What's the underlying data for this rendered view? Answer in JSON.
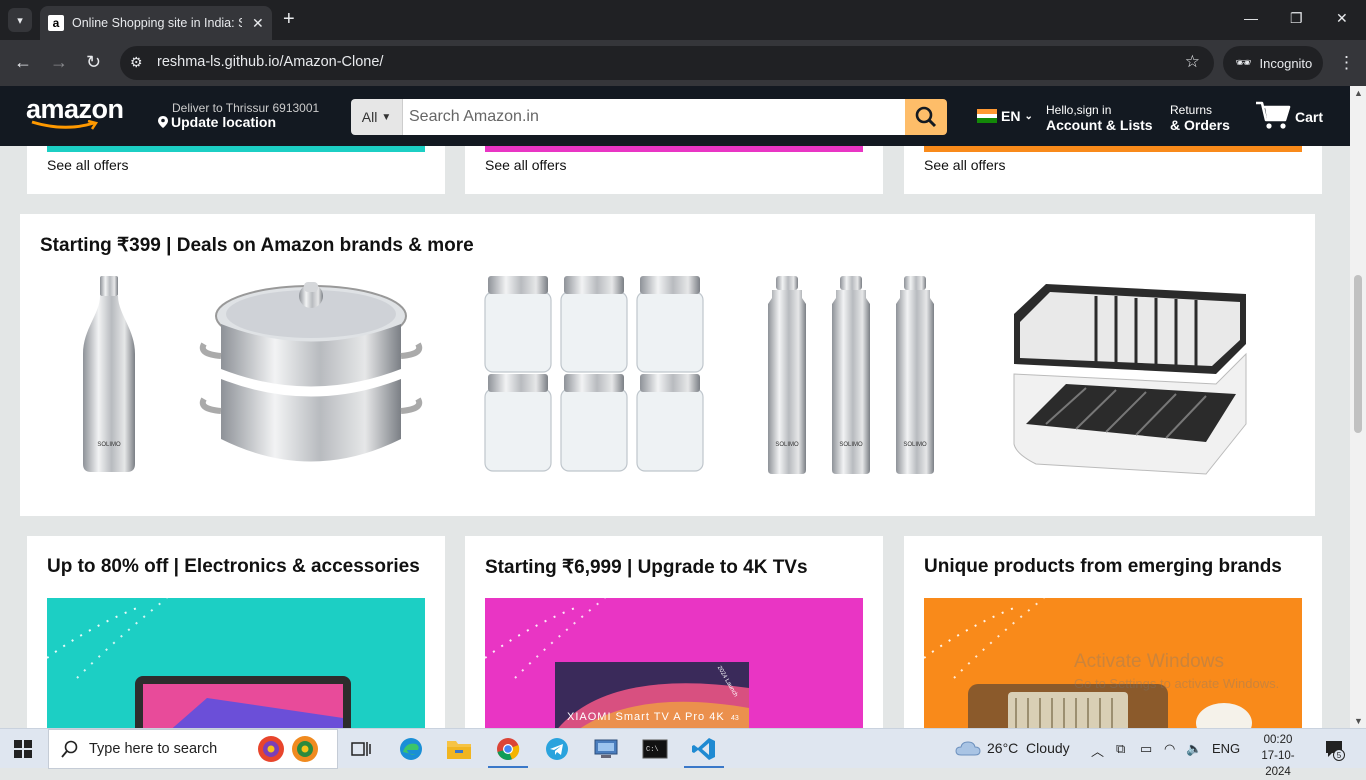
{
  "browser": {
    "tab_title": "Online Shopping site in India: S",
    "url": "reshma-ls.github.io/Amazon-Clone/",
    "incognito_label": "Incognito",
    "icons": [
      "tab-search-icon",
      "amazon-favicon",
      "close-icon",
      "new-tab-icon",
      "minimize-icon",
      "maximize-icon",
      "window-close-icon",
      "back-icon",
      "forward-icon",
      "reload-icon",
      "site-info-icon",
      "star-icon",
      "incognito-icon",
      "menu-icon"
    ]
  },
  "header": {
    "logo": "amazon",
    "deliver_line1": "Deliver to Thrissur 6913001",
    "deliver_line2": "Update location",
    "search_category": "All",
    "search_placeholder": "Search Amazon.in",
    "language": "EN",
    "account_small": "Hello,sign in",
    "account_big": "Account & Lists",
    "returns_small": "Returns",
    "returns_big": "& Orders",
    "cart_label": "Cart"
  },
  "top_cards": [
    {
      "link": "See all offers",
      "color": "#1ccfc4"
    },
    {
      "link": "See all offers",
      "color": "#e935c4"
    },
    {
      "link": "See all offers",
      "color": "#f98a1a"
    }
  ],
  "deals": {
    "title": "Starting ₹399 | Deals on Amazon brands & more",
    "products": [
      "steel-bottle",
      "steamer-pot",
      "glass-jars",
      "steel-bottles-set",
      "dish-rack"
    ],
    "brand_text": "SOLIMO"
  },
  "cards": [
    {
      "title": "Up to 80% off | Electronics & accessories",
      "bg": "#1ccfc4"
    },
    {
      "title": "Starting ₹6,999 | Upgrade to 4K TVs",
      "bg": "#e935c4",
      "tv_brand": "XIAOMI Smart TV A Pro 4K",
      "tv_size": "43",
      "tv_badge": "2024 Launch"
    },
    {
      "title": "Unique products from emerging brands",
      "bg": "#f98a1a"
    }
  ],
  "watermark": {
    "line1": "Activate Windows",
    "line2": "Go to Settings to activate Windows."
  },
  "taskbar": {
    "search_placeholder": "Type here to search",
    "weather": "26°C  Cloudy",
    "lang": "ENG",
    "time": "00:20",
    "date": "17-10-2024",
    "notifications": "5"
  }
}
